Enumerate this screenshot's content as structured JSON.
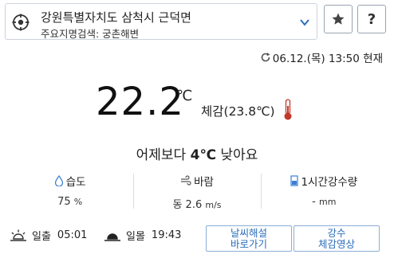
{
  "location": {
    "title": "강원특별자치도 삼척시 근덕면",
    "subtitle": "주요지명검색: 궁촌해변"
  },
  "icons": {
    "location": "crosshair-icon",
    "chevron": "chevron-down-icon",
    "favorite": "star-icon",
    "help": "help-icon",
    "refresh": "refresh-icon",
    "thermometer": "thermometer-icon",
    "humidity": "droplet-icon",
    "wind": "wind-icon",
    "rain": "rain-gauge-icon",
    "sunrise": "sunrise-icon",
    "sunset": "sunset-icon"
  },
  "buttons": {
    "help_label": "?"
  },
  "update_time": "06.12.(목) 13:50 현재",
  "current": {
    "temperature": "22.2",
    "unit": "℃",
    "feels_like": "체감(23.8℃)",
    "compare_prefix": "어제보다 ",
    "compare_value": "4℃",
    "compare_suffix": " 낮아요"
  },
  "stats": [
    {
      "label": "습도",
      "value": "75",
      "unit": "%"
    },
    {
      "label": "바람",
      "value": "동 2.6",
      "unit": "m/s"
    },
    {
      "label": "1시간강수량",
      "value": "-",
      "unit": "mm"
    }
  ],
  "sun": {
    "sunrise_label": "일출",
    "sunrise_time": "05:01",
    "sunset_label": "일몰",
    "sunset_time": "19:43"
  },
  "actions": {
    "explain_line1": "날씨해설",
    "explain_line2": "바로가기",
    "video_line1": "강수",
    "video_line2": "체감영상"
  },
  "colors": {
    "accent": "#2a6cbb",
    "thermometer": "#c0392b",
    "rain": "#3a7fd5"
  }
}
